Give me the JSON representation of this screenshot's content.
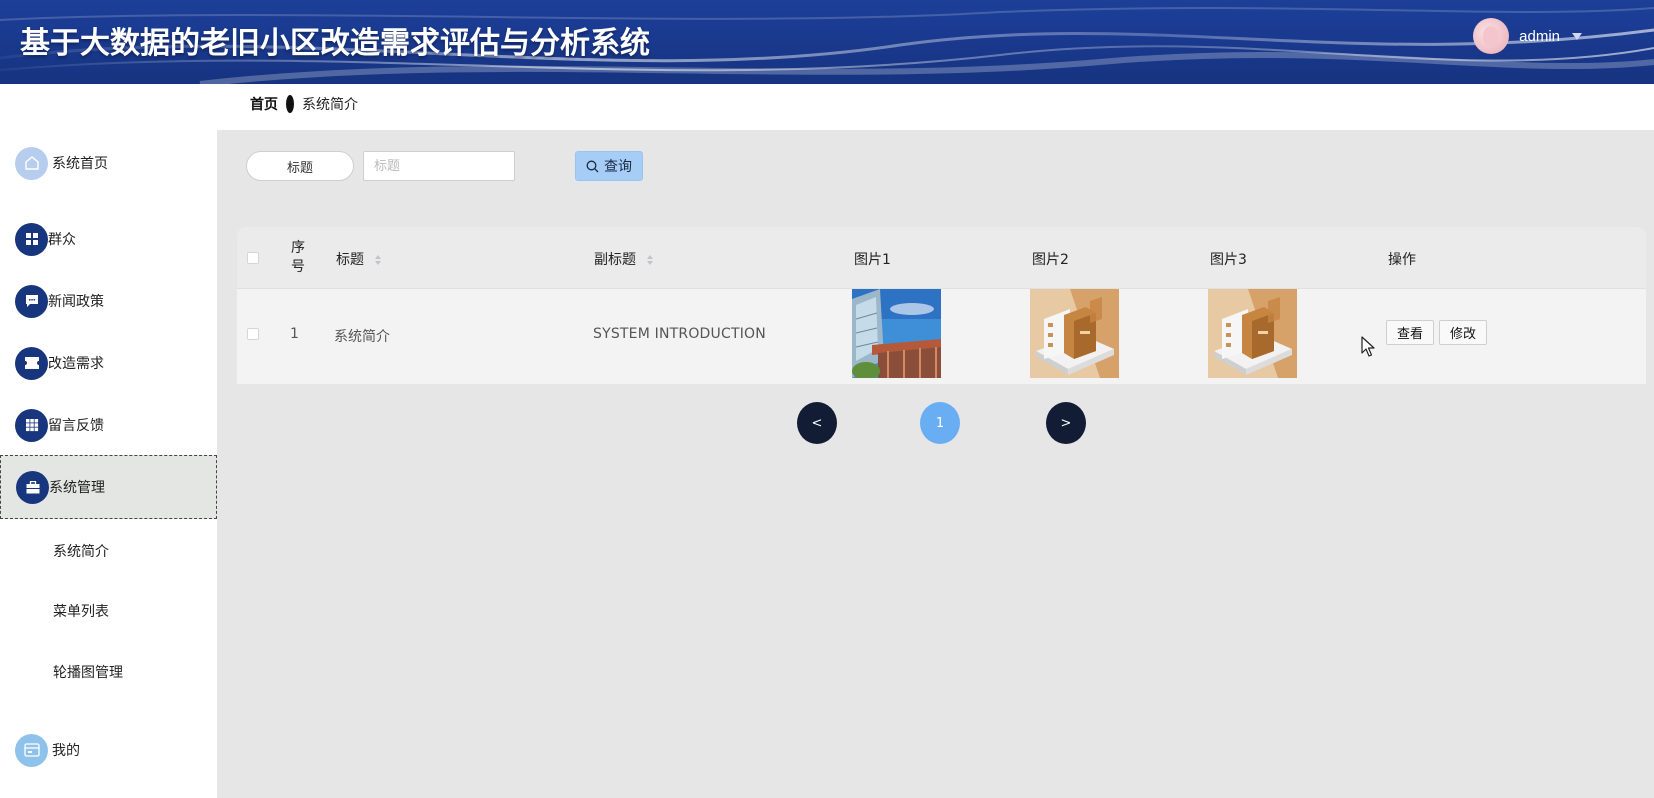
{
  "header": {
    "title": "基于大数据的老旧小区改造需求评估与分析系统",
    "username": "admin"
  },
  "breadcrumb": {
    "home": "首页",
    "current": "系统简介"
  },
  "sidebar": {
    "items": [
      {
        "label": "系统首页",
        "icon": "home-icon"
      },
      {
        "label": "群众",
        "icon": "grid-icon"
      },
      {
        "label": "新闻政策",
        "icon": "message-icon"
      },
      {
        "label": "改造需求",
        "icon": "ticket-icon"
      },
      {
        "label": "留言反馈",
        "icon": "apps-icon"
      },
      {
        "label": "系统管理",
        "icon": "briefcase-icon"
      },
      {
        "label": "我的",
        "icon": "card-icon"
      }
    ],
    "sub_items": [
      "系统简介",
      "菜单列表",
      "轮播图管理"
    ]
  },
  "search": {
    "label": "标题",
    "placeholder": "标题",
    "button_label": "查询"
  },
  "table": {
    "headers": {
      "index_line1": "序",
      "index_line2": "号",
      "title": "标题",
      "subtitle": "副标题",
      "img1": "图片1",
      "img2": "图片2",
      "img3": "图片3",
      "actions": "操作"
    },
    "rows": [
      {
        "index": "1",
        "title": "系统简介",
        "subtitle": "SYSTEM INTRODUCTION",
        "view_label": "查看",
        "edit_label": "修改"
      }
    ]
  },
  "pagination": {
    "prev": "<",
    "current": "1",
    "next": ">"
  },
  "colors": {
    "header_bg": "#1a3a90",
    "nav_icon_dark": "#17367d",
    "page_current": "#69aef3",
    "page_nav": "#121c35",
    "search_button": "#a6cdf6"
  }
}
